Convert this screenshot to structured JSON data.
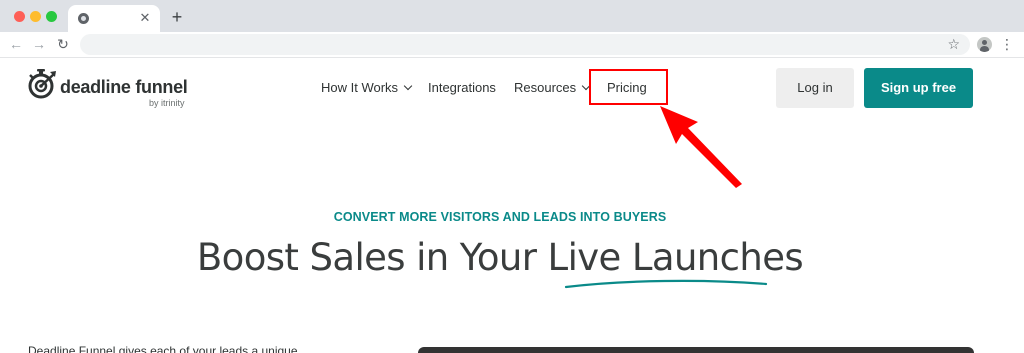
{
  "browser": {
    "tab_close_glyph": "✕",
    "new_tab_glyph": "+",
    "back_glyph": "←",
    "forward_glyph": "→",
    "reload_glyph": "↻",
    "star_glyph": "☆",
    "menu_glyph": "⋮",
    "icons": [
      "chrome-favicon-icon",
      "close-icon",
      "plus-icon",
      "back-arrow-icon",
      "forward-arrow-icon",
      "reload-icon",
      "star-icon",
      "profile-icon",
      "kebab-menu-icon"
    ]
  },
  "site": {
    "logo": {
      "name": "deadline funnel",
      "sub": "by itrinity"
    },
    "nav": [
      {
        "label": "How It Works",
        "has_dropdown": true
      },
      {
        "label": "Integrations",
        "has_dropdown": false
      },
      {
        "label": "Resources",
        "has_dropdown": true
      },
      {
        "label": "Pricing",
        "has_dropdown": false
      }
    ],
    "login_label": "Log in",
    "signup_label": "Sign up free"
  },
  "hero": {
    "eyebrow": "CONVERT MORE VISITORS AND LEADS INTO BUYERS",
    "title": "Boost Sales in Your Live Launches",
    "body_partial": "Deadline Funnel gives each of your leads a unique"
  },
  "colors": {
    "brand_teal": "#0a8a89",
    "highlight_red": "#ff0000",
    "text_dark": "#2f3333",
    "login_bg": "#eeeeee"
  }
}
